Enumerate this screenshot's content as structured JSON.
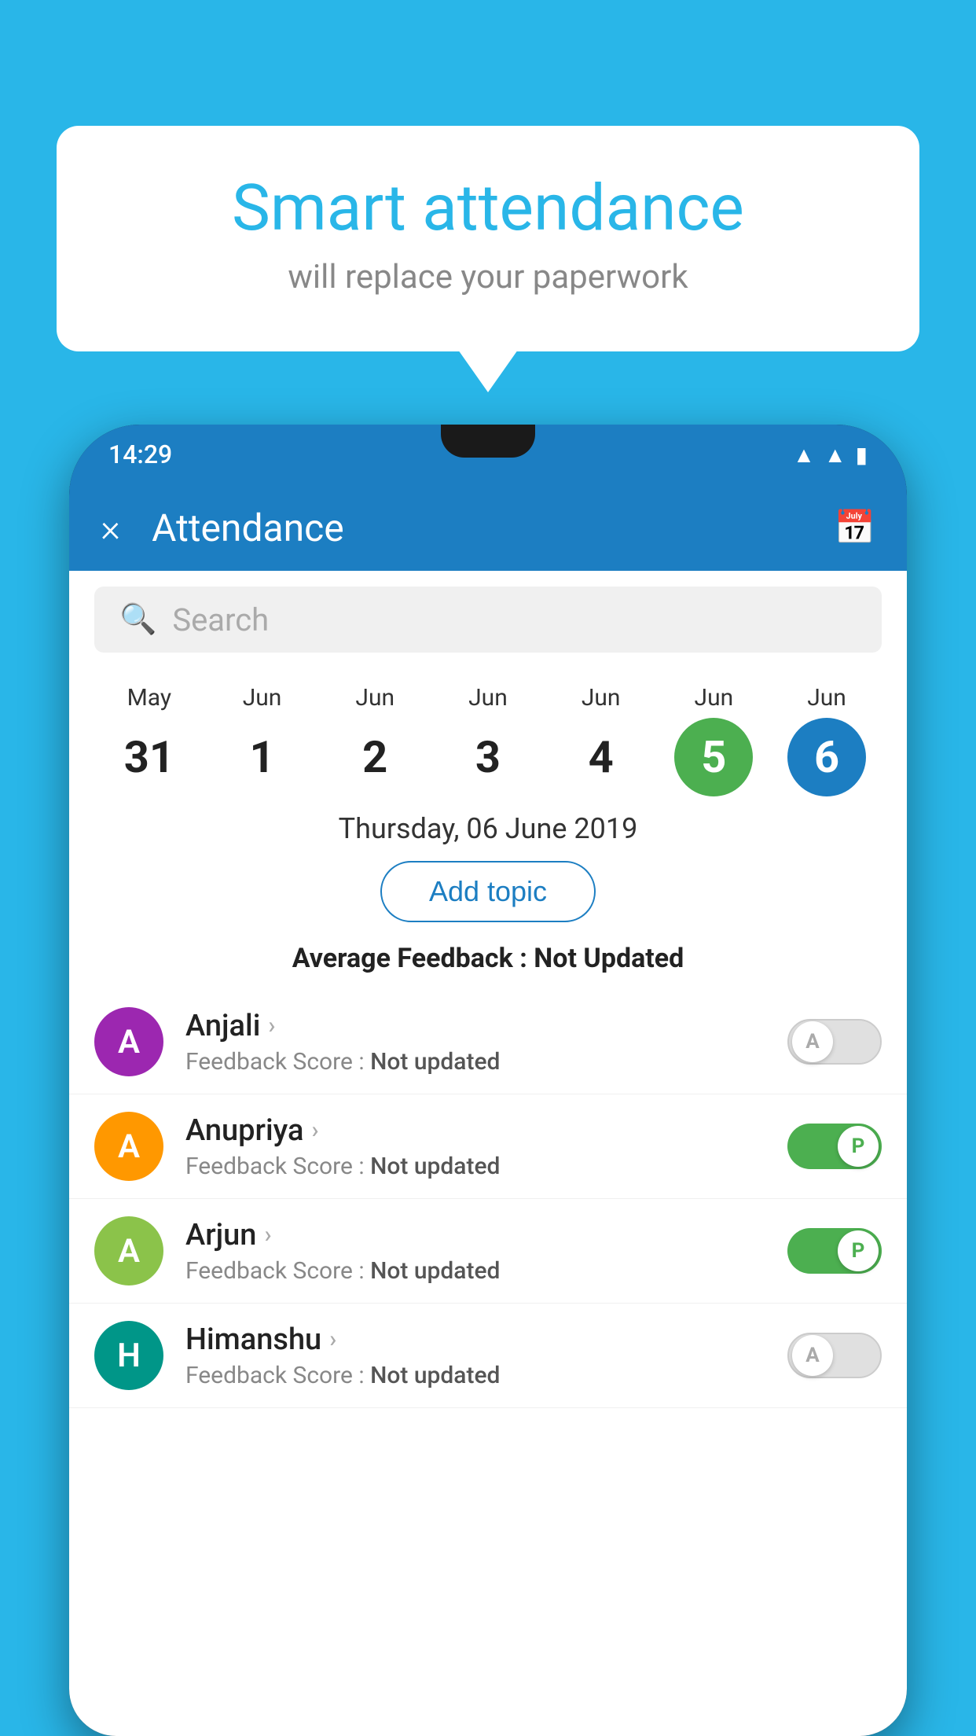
{
  "background_color": "#29B6E8",
  "speech_bubble": {
    "title": "Smart attendance",
    "subtitle": "will replace your paperwork"
  },
  "status_bar": {
    "time": "14:29",
    "icons": [
      "wifi",
      "signal",
      "battery"
    ]
  },
  "app_bar": {
    "title": "Attendance",
    "close_label": "×",
    "calendar_icon": "📅"
  },
  "search": {
    "placeholder": "Search"
  },
  "date_strip": {
    "dates": [
      {
        "month": "May",
        "day": "31",
        "active": false
      },
      {
        "month": "Jun",
        "day": "1",
        "active": false
      },
      {
        "month": "Jun",
        "day": "2",
        "active": false
      },
      {
        "month": "Jun",
        "day": "3",
        "active": false
      },
      {
        "month": "Jun",
        "day": "4",
        "active": false
      },
      {
        "month": "Jun",
        "day": "5",
        "active": "green"
      },
      {
        "month": "Jun",
        "day": "6",
        "active": "blue"
      }
    ]
  },
  "selected_date": "Thursday, 06 June 2019",
  "add_topic_label": "Add topic",
  "average_feedback": {
    "label": "Average Feedback : ",
    "value": "Not Updated"
  },
  "students": [
    {
      "name": "Anjali",
      "avatar_letter": "A",
      "avatar_color": "avatar-purple",
      "feedback_label": "Feedback Score : ",
      "feedback_value": "Not updated",
      "attendance": "absent",
      "toggle_letter": "A"
    },
    {
      "name": "Anupriya",
      "avatar_letter": "A",
      "avatar_color": "avatar-orange",
      "feedback_label": "Feedback Score : ",
      "feedback_value": "Not updated",
      "attendance": "present",
      "toggle_letter": "P"
    },
    {
      "name": "Arjun",
      "avatar_letter": "A",
      "avatar_color": "avatar-green",
      "feedback_label": "Feedback Score : ",
      "feedback_value": "Not updated",
      "attendance": "present",
      "toggle_letter": "P"
    },
    {
      "name": "Himanshu",
      "avatar_letter": "H",
      "avatar_color": "avatar-teal",
      "feedback_label": "Feedback Score : ",
      "feedback_value": "Not updated",
      "attendance": "absent",
      "toggle_letter": "A"
    }
  ]
}
